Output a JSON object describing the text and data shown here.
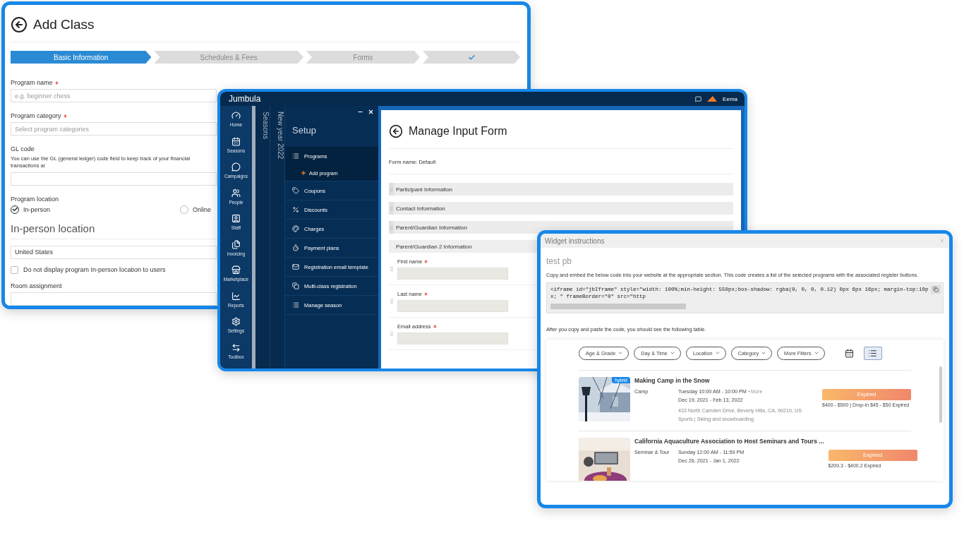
{
  "add_class": {
    "title": "Add Class",
    "steps": [
      {
        "kind": "label",
        "label": "Basic Information",
        "selected": true
      },
      {
        "kind": "label",
        "label": "Schedules & Fees",
        "selected": false
      },
      {
        "kind": "label",
        "label": "Forms",
        "selected": false
      },
      {
        "kind": "check",
        "selected": false
      }
    ],
    "program_name": {
      "label": "Program name",
      "required": true,
      "placeholder": "e.g. beginner chess"
    },
    "program_category": {
      "label": "Program category",
      "required": true,
      "placeholder": "Select program categories"
    },
    "gl_code": {
      "label": "GL code",
      "help": "You can use the GL (general ledger) code field to keep track of your financial transactions ar"
    },
    "program_location": {
      "label": "Program location",
      "options": [
        {
          "label": "In-person",
          "selected": true
        },
        {
          "label": "Online",
          "selected": false
        }
      ]
    },
    "location_heading": "In-person location",
    "country": {
      "value": "United States"
    },
    "hide_location": {
      "label": "Do not display program In-person location to users",
      "checked": false
    },
    "room_assignment": {
      "label": "Room assignment"
    }
  },
  "jumbula": {
    "brand": "Jumbula",
    "user": "Eema",
    "nav": [
      {
        "label": "Home"
      },
      {
        "label": "Seasons"
      },
      {
        "label": "Campaigns"
      },
      {
        "label": "People"
      },
      {
        "label": "Staff"
      },
      {
        "label": "Invoicing"
      },
      {
        "label": "Marketplace"
      },
      {
        "label": "Reports"
      },
      {
        "label": "Settings"
      },
      {
        "label": "Toolbox"
      }
    ],
    "vertical_tabs": [
      {
        "label": "Seasons"
      },
      {
        "label": "New year 2022"
      }
    ],
    "setup": {
      "title": "Setup",
      "items": [
        {
          "label": "Programs",
          "selected": true,
          "children": [
            {
              "label": "Add program"
            }
          ]
        },
        {
          "label": "Coupons",
          "selected": false
        },
        {
          "label": "Discounts",
          "selected": false
        },
        {
          "label": "Charges",
          "selected": false
        },
        {
          "label": "Payment plans",
          "selected": false
        },
        {
          "label": "Registration email template",
          "selected": false
        },
        {
          "label": "Multi-class registration",
          "selected": false
        },
        {
          "label": "Manage season",
          "selected": false
        }
      ]
    },
    "page": {
      "title": "Manage Input Form",
      "form_name": "Form name: Default",
      "sections": [
        {
          "title": "Participant Information",
          "expanded": false
        },
        {
          "title": "Contact Information",
          "expanded": false
        },
        {
          "title": "Parent/Guardian Information",
          "expanded": false
        },
        {
          "title": "Parent/Guardian 2 Information",
          "expanded": true,
          "fields": [
            {
              "label": "First name",
              "required": true
            },
            {
              "label": "Last name",
              "required": true
            },
            {
              "label": "Email address",
              "required": true
            }
          ]
        }
      ]
    }
  },
  "widget": {
    "title": "Widget instructions",
    "name": "test pb",
    "description": "Copy and embed the below code into your website at the appropriate section. This code creates a list of the selected programs with the associated register buttons.",
    "code": "<iframe id=\"jbIframe\" style=\"width: 100%;min-height: 550px;box-shadow: rgba(0, 0, 0, 0.12) 0px 6px 16px; margin-top:10px; \" frameBorder=\"0\" src=\"http",
    "hint": "After you copy and paste the code, you should see the following table.",
    "filters": [
      {
        "label": "Age & Grade"
      },
      {
        "label": "Day & Time"
      },
      {
        "label": "Location"
      },
      {
        "label": "Category"
      },
      {
        "label": "More Filters"
      }
    ],
    "views": [
      {
        "kind": "calendar",
        "selected": false
      },
      {
        "kind": "list",
        "selected": true
      }
    ],
    "programs": [
      {
        "title": "Making Camp in the Snow",
        "badge": "hybrid",
        "category": "Camp",
        "schedule": "Tuesday 10:00 AM - 10:00 PM",
        "more": "+More",
        "dates": "Dec 19, 2021 - Feb 13, 2022",
        "address": "433 North Camden Drive, Beverly Hills, CA, 90210, US",
        "tags": "Sports | Skiing and snowboarding",
        "status": "Expired",
        "price": "$400 - $500 | Drop-in $45 - $50 Expired"
      },
      {
        "title": "California Aquaculture Association to Host Seminars and Tours ...",
        "category": "Seminar & Tour",
        "schedule": "Sunday 12:00 AM - 11:59 PM",
        "dates": "Dec 26, 2021 - Jan 1, 2022",
        "status": "Expired",
        "price": "$200.3 - $400.2 Expired"
      }
    ]
  }
}
